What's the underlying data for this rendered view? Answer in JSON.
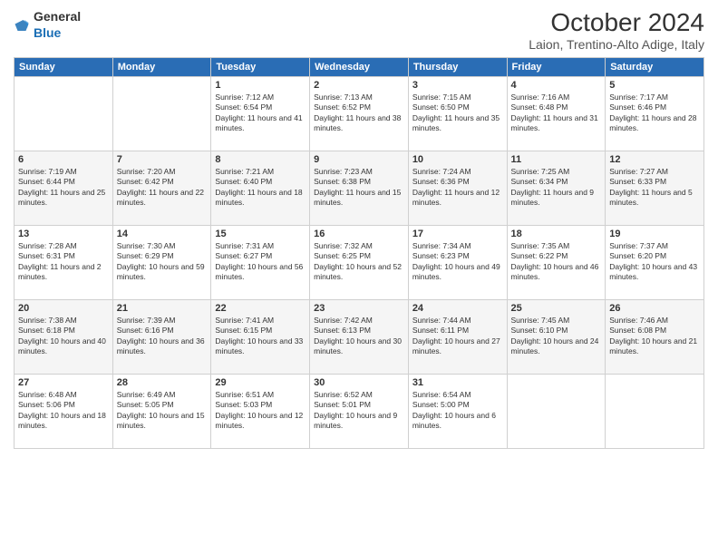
{
  "header": {
    "logo_general": "General",
    "logo_blue": "Blue",
    "month_title": "October 2024",
    "location": "Laion, Trentino-Alto Adige, Italy"
  },
  "weekdays": [
    "Sunday",
    "Monday",
    "Tuesday",
    "Wednesday",
    "Thursday",
    "Friday",
    "Saturday"
  ],
  "weeks": [
    [
      null,
      null,
      {
        "day": 1,
        "sunrise": "7:12 AM",
        "sunset": "6:54 PM",
        "daylight": "11 hours and 41 minutes."
      },
      {
        "day": 2,
        "sunrise": "7:13 AM",
        "sunset": "6:52 PM",
        "daylight": "11 hours and 38 minutes."
      },
      {
        "day": 3,
        "sunrise": "7:15 AM",
        "sunset": "6:50 PM",
        "daylight": "11 hours and 35 minutes."
      },
      {
        "day": 4,
        "sunrise": "7:16 AM",
        "sunset": "6:48 PM",
        "daylight": "11 hours and 31 minutes."
      },
      {
        "day": 5,
        "sunrise": "7:17 AM",
        "sunset": "6:46 PM",
        "daylight": "11 hours and 28 minutes."
      }
    ],
    [
      {
        "day": 6,
        "sunrise": "7:19 AM",
        "sunset": "6:44 PM",
        "daylight": "11 hours and 25 minutes."
      },
      {
        "day": 7,
        "sunrise": "7:20 AM",
        "sunset": "6:42 PM",
        "daylight": "11 hours and 22 minutes."
      },
      {
        "day": 8,
        "sunrise": "7:21 AM",
        "sunset": "6:40 PM",
        "daylight": "11 hours and 18 minutes."
      },
      {
        "day": 9,
        "sunrise": "7:23 AM",
        "sunset": "6:38 PM",
        "daylight": "11 hours and 15 minutes."
      },
      {
        "day": 10,
        "sunrise": "7:24 AM",
        "sunset": "6:36 PM",
        "daylight": "11 hours and 12 minutes."
      },
      {
        "day": 11,
        "sunrise": "7:25 AM",
        "sunset": "6:34 PM",
        "daylight": "11 hours and 9 minutes."
      },
      {
        "day": 12,
        "sunrise": "7:27 AM",
        "sunset": "6:33 PM",
        "daylight": "11 hours and 5 minutes."
      }
    ],
    [
      {
        "day": 13,
        "sunrise": "7:28 AM",
        "sunset": "6:31 PM",
        "daylight": "11 hours and 2 minutes."
      },
      {
        "day": 14,
        "sunrise": "7:30 AM",
        "sunset": "6:29 PM",
        "daylight": "10 hours and 59 minutes."
      },
      {
        "day": 15,
        "sunrise": "7:31 AM",
        "sunset": "6:27 PM",
        "daylight": "10 hours and 56 minutes."
      },
      {
        "day": 16,
        "sunrise": "7:32 AM",
        "sunset": "6:25 PM",
        "daylight": "10 hours and 52 minutes."
      },
      {
        "day": 17,
        "sunrise": "7:34 AM",
        "sunset": "6:23 PM",
        "daylight": "10 hours and 49 minutes."
      },
      {
        "day": 18,
        "sunrise": "7:35 AM",
        "sunset": "6:22 PM",
        "daylight": "10 hours and 46 minutes."
      },
      {
        "day": 19,
        "sunrise": "7:37 AM",
        "sunset": "6:20 PM",
        "daylight": "10 hours and 43 minutes."
      }
    ],
    [
      {
        "day": 20,
        "sunrise": "7:38 AM",
        "sunset": "6:18 PM",
        "daylight": "10 hours and 40 minutes."
      },
      {
        "day": 21,
        "sunrise": "7:39 AM",
        "sunset": "6:16 PM",
        "daylight": "10 hours and 36 minutes."
      },
      {
        "day": 22,
        "sunrise": "7:41 AM",
        "sunset": "6:15 PM",
        "daylight": "10 hours and 33 minutes."
      },
      {
        "day": 23,
        "sunrise": "7:42 AM",
        "sunset": "6:13 PM",
        "daylight": "10 hours and 30 minutes."
      },
      {
        "day": 24,
        "sunrise": "7:44 AM",
        "sunset": "6:11 PM",
        "daylight": "10 hours and 27 minutes."
      },
      {
        "day": 25,
        "sunrise": "7:45 AM",
        "sunset": "6:10 PM",
        "daylight": "10 hours and 24 minutes."
      },
      {
        "day": 26,
        "sunrise": "7:46 AM",
        "sunset": "6:08 PM",
        "daylight": "10 hours and 21 minutes."
      }
    ],
    [
      {
        "day": 27,
        "sunrise": "6:48 AM",
        "sunset": "5:06 PM",
        "daylight": "10 hours and 18 minutes."
      },
      {
        "day": 28,
        "sunrise": "6:49 AM",
        "sunset": "5:05 PM",
        "daylight": "10 hours and 15 minutes."
      },
      {
        "day": 29,
        "sunrise": "6:51 AM",
        "sunset": "5:03 PM",
        "daylight": "10 hours and 12 minutes."
      },
      {
        "day": 30,
        "sunrise": "6:52 AM",
        "sunset": "5:01 PM",
        "daylight": "10 hours and 9 minutes."
      },
      {
        "day": 31,
        "sunrise": "6:54 AM",
        "sunset": "5:00 PM",
        "daylight": "10 hours and 6 minutes."
      },
      null,
      null
    ]
  ],
  "labels": {
    "sunrise": "Sunrise:",
    "sunset": "Sunset:",
    "daylight": "Daylight:"
  }
}
